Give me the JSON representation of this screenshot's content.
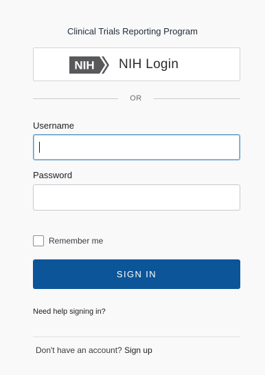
{
  "header": {
    "program_title": "Clinical Trials Reporting Program"
  },
  "nih_login": {
    "logo_text": "NIH",
    "label": "NIH Login"
  },
  "separator": {
    "text": "OR"
  },
  "form": {
    "username_label": "Username",
    "username_value": "",
    "password_label": "Password",
    "password_value": "",
    "remember_label": "Remember me",
    "remember_checked": false,
    "submit_label": "SIGN IN"
  },
  "footer": {
    "help_link": "Need help signing in?",
    "no_account_text": "Don't have an account?",
    "signup_link": "Sign up"
  },
  "colors": {
    "primary_button": "#0c5599",
    "nih_logo_gray": "#58595b",
    "focus_border": "#5a98c0"
  }
}
